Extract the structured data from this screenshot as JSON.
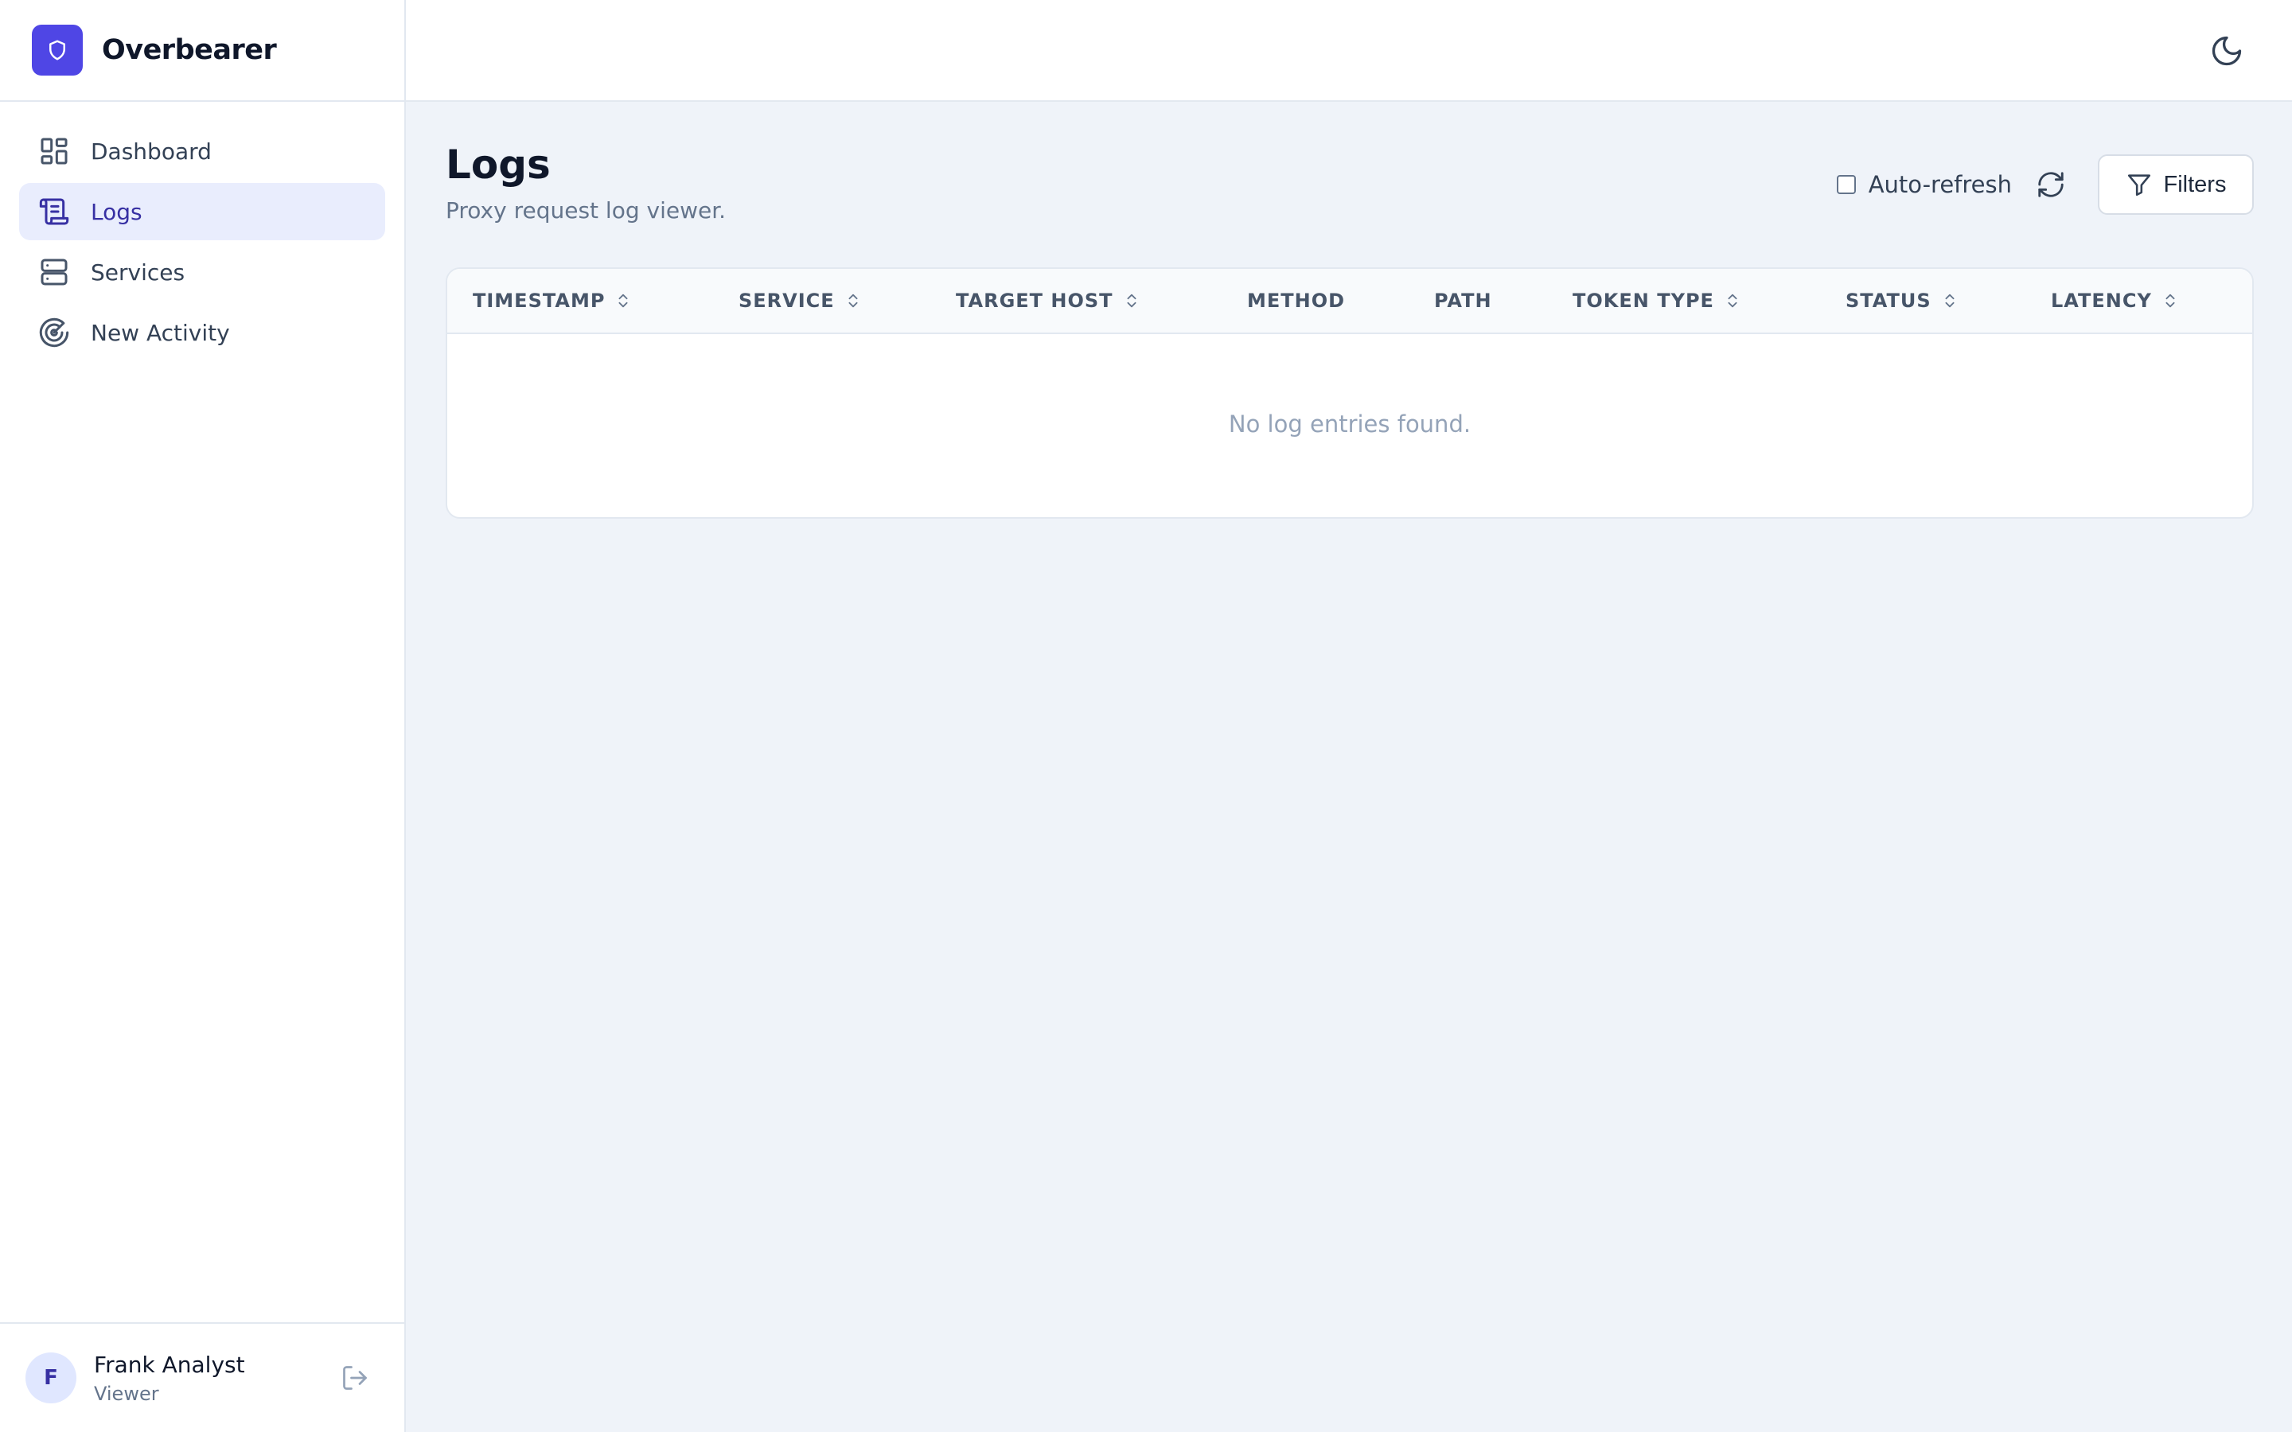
{
  "app": {
    "name": "Overbearer"
  },
  "sidebar": {
    "items": [
      {
        "label": "Dashboard",
        "icon": "dashboard-icon",
        "active": false
      },
      {
        "label": "Logs",
        "icon": "scroll-icon",
        "active": true
      },
      {
        "label": "Services",
        "icon": "server-icon",
        "active": false
      },
      {
        "label": "New Activity",
        "icon": "radar-icon",
        "active": false
      }
    ]
  },
  "user": {
    "initial": "F",
    "name": "Frank Analyst",
    "role": "Viewer"
  },
  "page": {
    "title": "Logs",
    "subtitle": "Proxy request log viewer."
  },
  "toolbar": {
    "auto_refresh_label": "Auto-refresh",
    "auto_refresh_checked": false,
    "filters_label": "Filters"
  },
  "table": {
    "columns": [
      {
        "label": "TIMESTAMP",
        "sortable": true
      },
      {
        "label": "SERVICE",
        "sortable": true
      },
      {
        "label": "TARGET HOST",
        "sortable": true
      },
      {
        "label": "METHOD",
        "sortable": false
      },
      {
        "label": "PATH",
        "sortable": false
      },
      {
        "label": "TOKEN TYPE",
        "sortable": true
      },
      {
        "label": "STATUS",
        "sortable": true
      },
      {
        "label": "LATENCY",
        "sortable": true
      }
    ],
    "rows": [],
    "empty_message": "No log entries found."
  },
  "colors": {
    "accent": "#4f46e5",
    "active_nav_bg": "#e9edfd",
    "active_nav_text": "#3730a3",
    "page_bg": "#eff3f9"
  }
}
